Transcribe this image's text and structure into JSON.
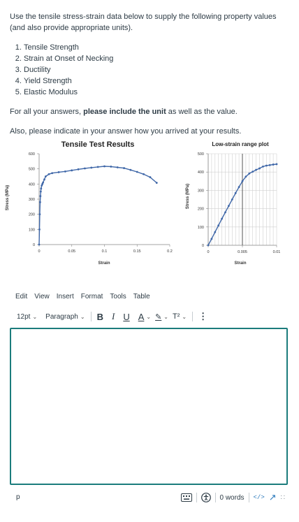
{
  "question": {
    "intro": "Use the tensile stress-strain data below to supply the following property values (and also provide appropriate units).",
    "items": [
      "Tensile Strength",
      "Strain at Onset of Necking",
      "Ductility",
      "Yield Strength",
      "Elastic Modulus"
    ],
    "units_before": "For all your answers, ",
    "units_bold": "please include the unit",
    "units_after": " as well as the value.",
    "explain": "Also, please indicate in your answer how you arrived at your results."
  },
  "chart_data": [
    {
      "type": "line",
      "title": "Tensile Test Results",
      "xlabel": "Strain",
      "ylabel": "Stress (MPa)",
      "xlim": [
        0,
        0.2
      ],
      "ylim": [
        0,
        600
      ],
      "xticks": [
        "0",
        "0.05",
        "0.1",
        "0.15",
        "0.2"
      ],
      "yticks": [
        "0",
        "100",
        "200",
        "300",
        "400",
        "500",
        "600"
      ],
      "grid": false,
      "x": [
        0,
        0.0005,
        0.001,
        0.0015,
        0.002,
        0.0025,
        0.003,
        0.004,
        0.005,
        0.006,
        0.008,
        0.01,
        0.015,
        0.02,
        0.03,
        0.04,
        0.05,
        0.06,
        0.07,
        0.08,
        0.09,
        0.1,
        0.11,
        0.12,
        0.13,
        0.14,
        0.15,
        0.16,
        0.17,
        0.18
      ],
      "y": [
        0,
        100,
        200,
        280,
        320,
        350,
        370,
        390,
        400,
        410,
        430,
        450,
        465,
        472,
        478,
        483,
        490,
        497,
        503,
        508,
        513,
        517,
        515,
        510,
        505,
        493,
        480,
        465,
        445,
        408
      ]
    },
    {
      "type": "line",
      "title": "Low-strain range plot",
      "xlabel": "Strain",
      "ylabel": "Stress (MPa)",
      "xlim": [
        0,
        0.01
      ],
      "ylim": [
        0,
        500
      ],
      "xticks": [
        "0",
        "0.005",
        "0.01"
      ],
      "yticks": [
        "0",
        "100",
        "200",
        "300",
        "400",
        "500"
      ],
      "grid": true,
      "vline_x": 0.005,
      "x": [
        0,
        0.0005,
        0.001,
        0.0015,
        0.002,
        0.0025,
        0.003,
        0.0035,
        0.004,
        0.0045,
        0.005,
        0.0055,
        0.006,
        0.0065,
        0.007,
        0.0075,
        0.008,
        0.0085,
        0.009,
        0.0095,
        0.01
      ],
      "y": [
        0,
        35,
        72,
        108,
        145,
        180,
        215,
        250,
        285,
        318,
        350,
        375,
        392,
        402,
        412,
        420,
        430,
        435,
        438,
        441,
        443
      ]
    }
  ],
  "editor": {
    "menu": [
      "Edit",
      "View",
      "Insert",
      "Format",
      "Tools",
      "Table"
    ],
    "font_size": "12pt",
    "block_format": "Paragraph",
    "bold": "B",
    "italic": "I",
    "underline": "U",
    "text_color": "A",
    "highlight": "✎",
    "superscript": "T²",
    "more": "⋮",
    "path": "p",
    "word_count": "0 words",
    "html_toggle": "</>",
    "fullscreen": "↗",
    "resize": "∷",
    "accent": "#1b7c7c"
  }
}
